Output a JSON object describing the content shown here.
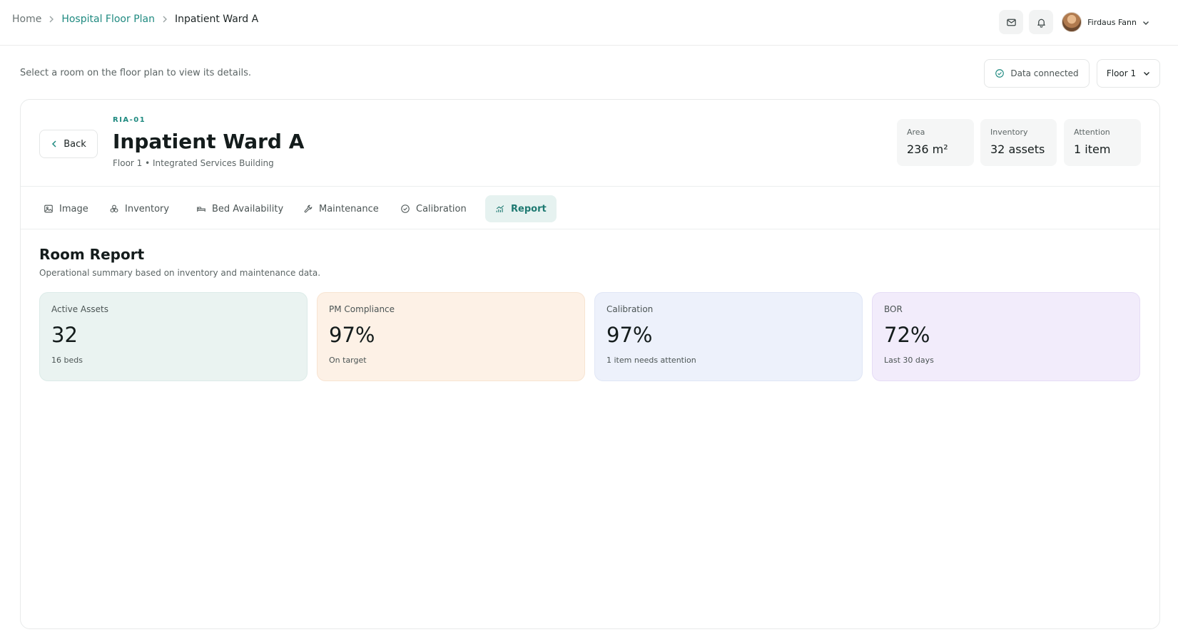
{
  "breadcrumb": {
    "home": "Home",
    "floor_plan": "Hospital Floor Plan",
    "current": "Inpatient Ward A"
  },
  "header": {
    "user_name": "Firdaus Fann"
  },
  "subheader": {
    "hint": "Select a room on the floor plan to view its details.",
    "status": "Data connected",
    "floor": "Floor 1"
  },
  "room": {
    "back_label": "Back",
    "code": "RIA-01",
    "title": "Inpatient Ward A",
    "subtitle": "Floor 1 • Integrated Services Building",
    "stats": [
      {
        "label": "Area",
        "value": "236 m²"
      },
      {
        "label": "Inventory",
        "value": "32 assets"
      },
      {
        "label": "Attention",
        "value": "1 item"
      }
    ]
  },
  "tabs": [
    {
      "label": "Image",
      "icon": "image-icon"
    },
    {
      "label": "Inventory",
      "icon": "boxes-icon"
    },
    {
      "label": "Bed Availability",
      "icon": "bed-icon"
    },
    {
      "label": "Maintenance",
      "icon": "wrench-icon"
    },
    {
      "label": "Calibration",
      "icon": "check-circle-icon"
    },
    {
      "label": "Report",
      "icon": "chart-icon"
    }
  ],
  "report": {
    "title": "Room Report",
    "subtitle": "Operational summary based on inventory and maintenance data.",
    "kpis": [
      {
        "label": "Active Assets",
        "value": "32",
        "note": "16 beds",
        "bg": "#eaf3f1",
        "border": "#dcebe8"
      },
      {
        "label": "PM Compliance",
        "value": "97%",
        "note": "On target",
        "bg": "#fdf1e6",
        "border": "#f7e4d2"
      },
      {
        "label": "Calibration",
        "value": "97%",
        "note": "1 item needs attention",
        "bg": "#edf1fb",
        "border": "#e0e6f6"
      },
      {
        "label": "BOR",
        "value": "72%",
        "note": "Last 30 days",
        "bg": "#f2ecfb",
        "border": "#e6ddf6"
      }
    ]
  },
  "colors": {
    "accent": "#1f8a80",
    "active_tab_bg": "#e6f2f0"
  }
}
